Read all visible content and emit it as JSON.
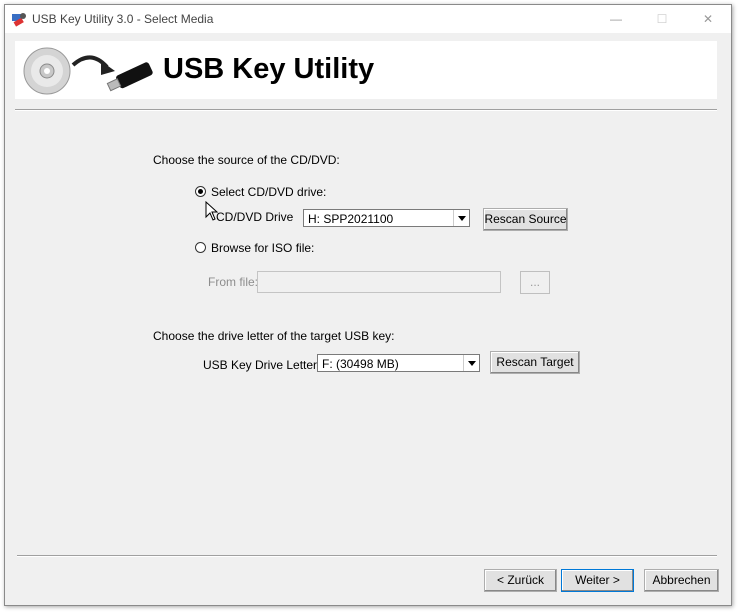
{
  "window": {
    "title": "USB Key Utility 3.0 - Select Media",
    "controls": {
      "minimize": "—",
      "maximize": "☐",
      "close": "✕"
    }
  },
  "banner": {
    "title": "USB Key Utility"
  },
  "source": {
    "heading": "Choose the source of the CD/DVD:",
    "option_drive": "Select CD/DVD drive:",
    "drive_label": "CD/DVD Drive",
    "drive_value": "H: SPP2021100",
    "rescan_source": "Rescan Source",
    "option_iso": "Browse for ISO file:",
    "from_file_label": "From file:",
    "from_file_value": "",
    "browse_button": "..."
  },
  "target": {
    "heading": "Choose the drive letter of the target USB key:",
    "drive_letter_label": "USB Key Drive Letter:",
    "drive_letter_value": "F: (30498 MB)",
    "rescan_target": "Rescan Target"
  },
  "footer": {
    "back": "< Zurück",
    "next": "Weiter >",
    "cancel": "Abbrechen"
  }
}
